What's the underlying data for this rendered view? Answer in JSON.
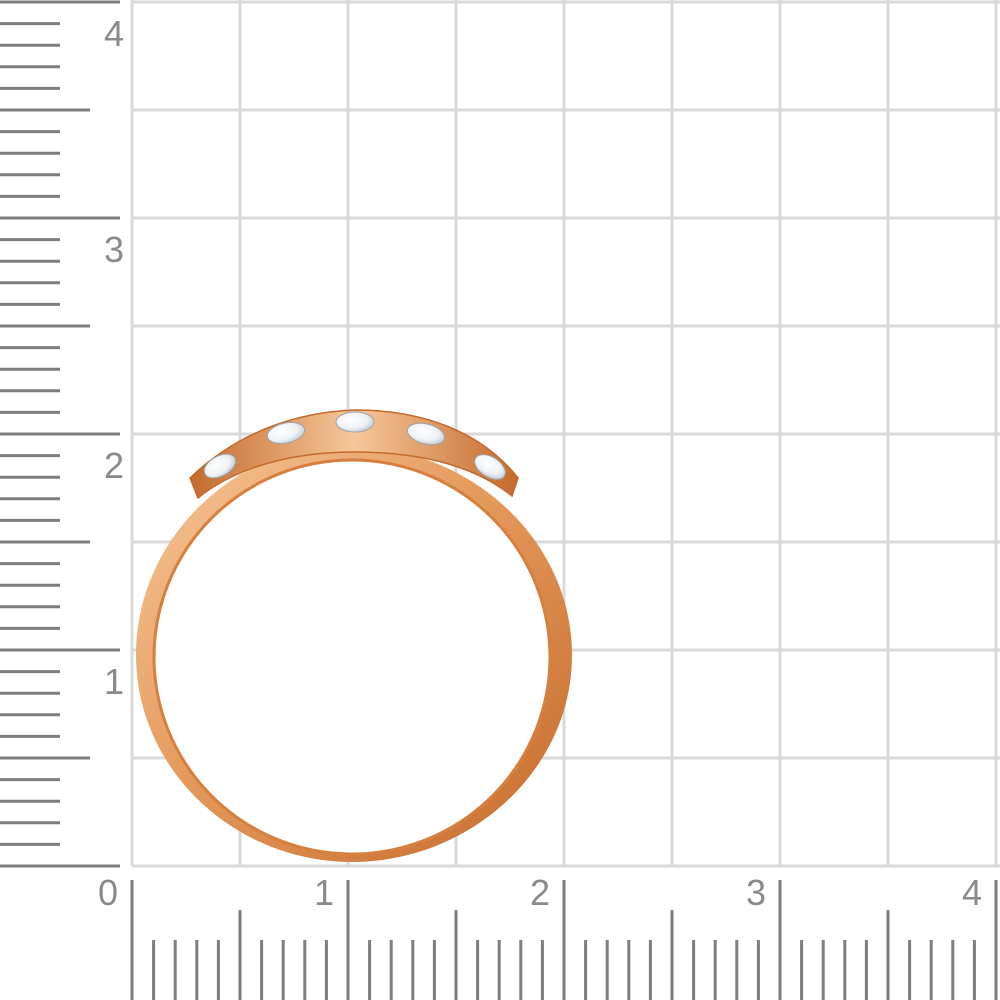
{
  "scale": {
    "unit_labels": [
      "0",
      "1",
      "2",
      "3",
      "4"
    ],
    "minor_ticks_per_unit": 10
  },
  "colors": {
    "background": "#ffffff",
    "grid_line": "#d9d9d9",
    "ruler_tick": "#7d7d7d",
    "ruler_label": "#8a8a8a",
    "gold_light": "#f6c79a",
    "gold_mid": "#e59a5c",
    "gold_dark": "#c46a2c",
    "stone": "#f2f4f6"
  },
  "subject": {
    "description_icon": "gold-ring-icon",
    "stone_count": 5
  }
}
